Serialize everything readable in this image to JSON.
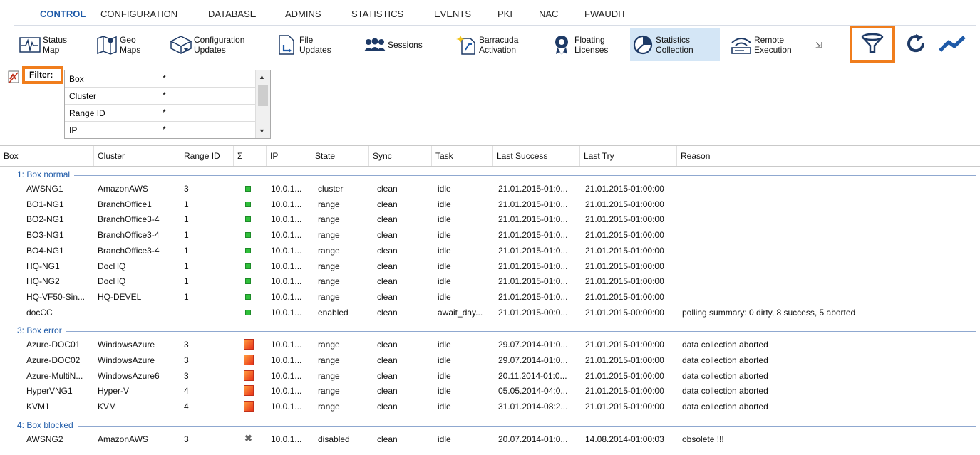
{
  "menu": [
    "CONTROL",
    "CONFIGURATION",
    "DATABASE",
    "ADMINS",
    "STATISTICS",
    "EVENTS",
    "PKI",
    "NAC",
    "FWAUDIT"
  ],
  "toolbar": [
    {
      "label": "Status\nMap",
      "icon": "pulse-icon"
    },
    {
      "label": "Geo\nMaps",
      "icon": "map-icon"
    },
    {
      "label": "Configuration\nUpdates",
      "icon": "boxes-icon"
    },
    {
      "label": "File\nUpdates",
      "icon": "file-icon"
    },
    {
      "label": "Sessions",
      "icon": "users-icon"
    },
    {
      "label": "Barracuda\nActivation",
      "icon": "activation-icon"
    },
    {
      "label": "Floating\nLicenses",
      "icon": "license-icon"
    },
    {
      "label": "Statistics\nCollection",
      "icon": "pie-chart-icon"
    },
    {
      "label": "Remote\nExecution",
      "icon": "wifi-icon"
    }
  ],
  "toolbar_right": {
    "expand_icon": "expand-icon",
    "filter_icon": "filter-icon",
    "refresh_icon": "refresh-icon",
    "chart_icon": "trend-icon"
  },
  "filter": {
    "label": "Filter:",
    "rows": [
      {
        "key": "Box",
        "value": "*"
      },
      {
        "key": "Cluster",
        "value": "*"
      },
      {
        "key": "Range ID",
        "value": "*"
      },
      {
        "key": "IP",
        "value": "*"
      }
    ]
  },
  "columns": [
    "Box",
    "Cluster",
    "Range ID",
    "Σ",
    "IP",
    "State",
    "Sync",
    "Task",
    "Last Success",
    "Last Try",
    "Reason"
  ],
  "groups": [
    {
      "title": "1: Box normal",
      "status": "ok",
      "rows": [
        [
          "AWSNG1",
          "AmazonAWS",
          "3",
          "10.0.1...",
          "cluster",
          "clean",
          "idle",
          "21.01.2015-01:0...",
          "21.01.2015-01:00:00",
          ""
        ],
        [
          "BO1-NG1",
          "BranchOffice1",
          "1",
          "10.0.1...",
          "range",
          "clean",
          "idle",
          "21.01.2015-01:0...",
          "21.01.2015-01:00:00",
          ""
        ],
        [
          "BO2-NG1",
          "BranchOffice3-4",
          "1",
          "10.0.1...",
          "range",
          "clean",
          "idle",
          "21.01.2015-01:0...",
          "21.01.2015-01:00:00",
          ""
        ],
        [
          "BO3-NG1",
          "BranchOffice3-4",
          "1",
          "10.0.1...",
          "range",
          "clean",
          "idle",
          "21.01.2015-01:0...",
          "21.01.2015-01:00:00",
          ""
        ],
        [
          "BO4-NG1",
          "BranchOffice3-4",
          "1",
          "10.0.1...",
          "range",
          "clean",
          "idle",
          "21.01.2015-01:0...",
          "21.01.2015-01:00:00",
          ""
        ],
        [
          "HQ-NG1",
          "DocHQ",
          "1",
          "10.0.1...",
          "range",
          "clean",
          "idle",
          "21.01.2015-01:0...",
          "21.01.2015-01:00:00",
          ""
        ],
        [
          "HQ-NG2",
          "DocHQ",
          "1",
          "10.0.1...",
          "range",
          "clean",
          "idle",
          "21.01.2015-01:0...",
          "21.01.2015-01:00:00",
          ""
        ],
        [
          "HQ-VF50-Sin...",
          "HQ-DEVEL",
          "1",
          "10.0.1...",
          "range",
          "clean",
          "idle",
          "21.01.2015-01:0...",
          "21.01.2015-01:00:00",
          ""
        ],
        [
          "docCC",
          "",
          "",
          "10.0.1...",
          "enabled",
          "clean",
          "await_day...",
          "21.01.2015-00:0...",
          "21.01.2015-00:00:00",
          "polling summary: 0 dirty, 8 success, 5 aborted"
        ]
      ]
    },
    {
      "title": "3: Box error",
      "status": "error",
      "rows": [
        [
          "Azure-DOC01",
          "WindowsAzure",
          "3",
          "10.0.1...",
          "range",
          "clean",
          "idle",
          "29.07.2014-01:0...",
          "21.01.2015-01:00:00",
          "data collection aborted"
        ],
        [
          "Azure-DOC02",
          "WindowsAzure",
          "3",
          "10.0.1...",
          "range",
          "clean",
          "idle",
          "29.07.2014-01:0...",
          "21.01.2015-01:00:00",
          "data collection aborted"
        ],
        [
          "Azure-MultiN...",
          "WindowsAzure6",
          "3",
          "10.0.1...",
          "range",
          "clean",
          "idle",
          "20.11.2014-01:0...",
          "21.01.2015-01:00:00",
          "data collection aborted"
        ],
        [
          "HyperVNG1",
          "Hyper-V",
          "4",
          "10.0.1...",
          "range",
          "clean",
          "idle",
          "05.05.2014-04:0...",
          "21.01.2015-01:00:00",
          "data collection aborted"
        ],
        [
          "KVM1",
          "KVM",
          "4",
          "10.0.1...",
          "range",
          "clean",
          "idle",
          "31.01.2014-08:2...",
          "21.01.2015-01:00:00",
          "data collection aborted"
        ]
      ]
    },
    {
      "title": "4: Box blocked",
      "status": "blocked",
      "rows": [
        [
          "AWSNG2",
          "AmazonAWS",
          "3",
          "10.0.1...",
          "disabled",
          "clean",
          "idle",
          "20.07.2014-01:0...",
          "14.08.2014-01:00:03",
          "obsolete !!!"
        ]
      ]
    }
  ],
  "colors": {
    "accent": "#1e5aa8",
    "highlight": "#f07d1c",
    "selected": "#d4e6f6",
    "ok": "#2fbf3a",
    "error": "#e8341a"
  }
}
